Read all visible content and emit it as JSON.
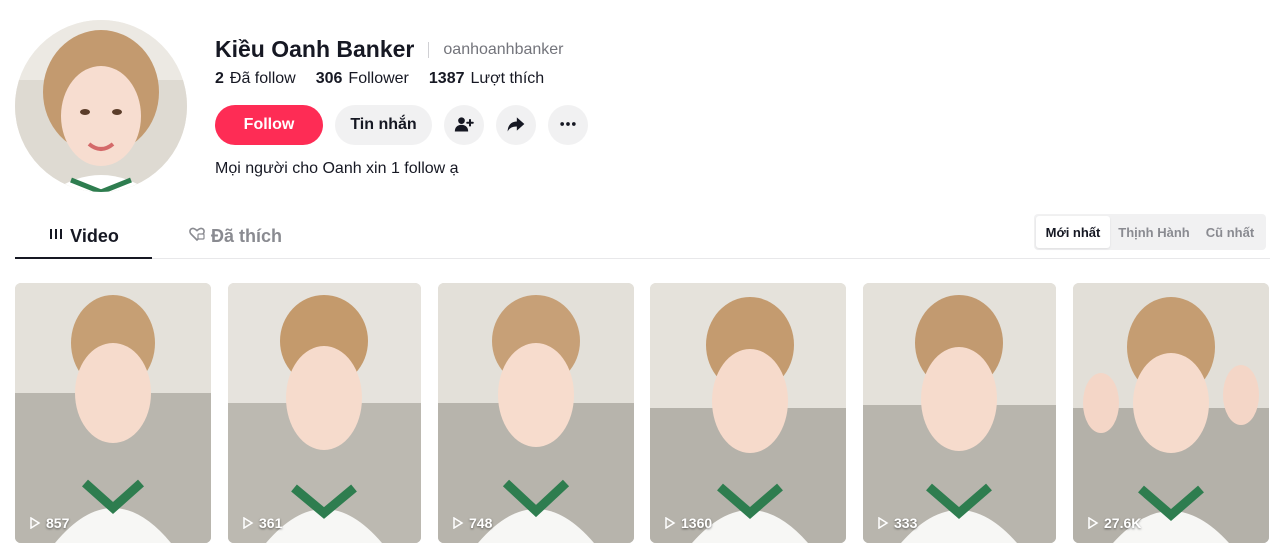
{
  "profile": {
    "display_name": "Kiều Oanh Banker",
    "username": "oanhoanhbanker",
    "stats": [
      {
        "value": "2",
        "label": "Đã follow"
      },
      {
        "value": "306",
        "label": "Follower"
      },
      {
        "value": "1387",
        "label": "Lượt thích"
      }
    ],
    "bio": "Mọi người cho Oanh xin 1 follow ạ"
  },
  "actions": {
    "follow_label": "Follow",
    "message_label": "Tin nhắn",
    "add_friend_icon": "add-friend-icon",
    "share_icon": "share-icon",
    "more_icon": "more-icon"
  },
  "tabs": [
    {
      "label": "Video",
      "icon": "grid-icon",
      "active": true
    },
    {
      "label": "Đã thích",
      "icon": "liked-heart-icon",
      "active": false
    }
  ],
  "sort": {
    "options": [
      "Mới nhất",
      "Thịnh Hành",
      "Cũ nhất"
    ],
    "selected": "Mới nhất"
  },
  "videos": [
    {
      "views": "857"
    },
    {
      "views": "361"
    },
    {
      "views": "748"
    },
    {
      "views": "1360"
    },
    {
      "views": "333"
    },
    {
      "views": "27.6K"
    }
  ],
  "colors": {
    "primary": "#fe2c55",
    "text": "#161823",
    "secondary_text": "#73747b",
    "button_bg": "#f1f1f2"
  }
}
